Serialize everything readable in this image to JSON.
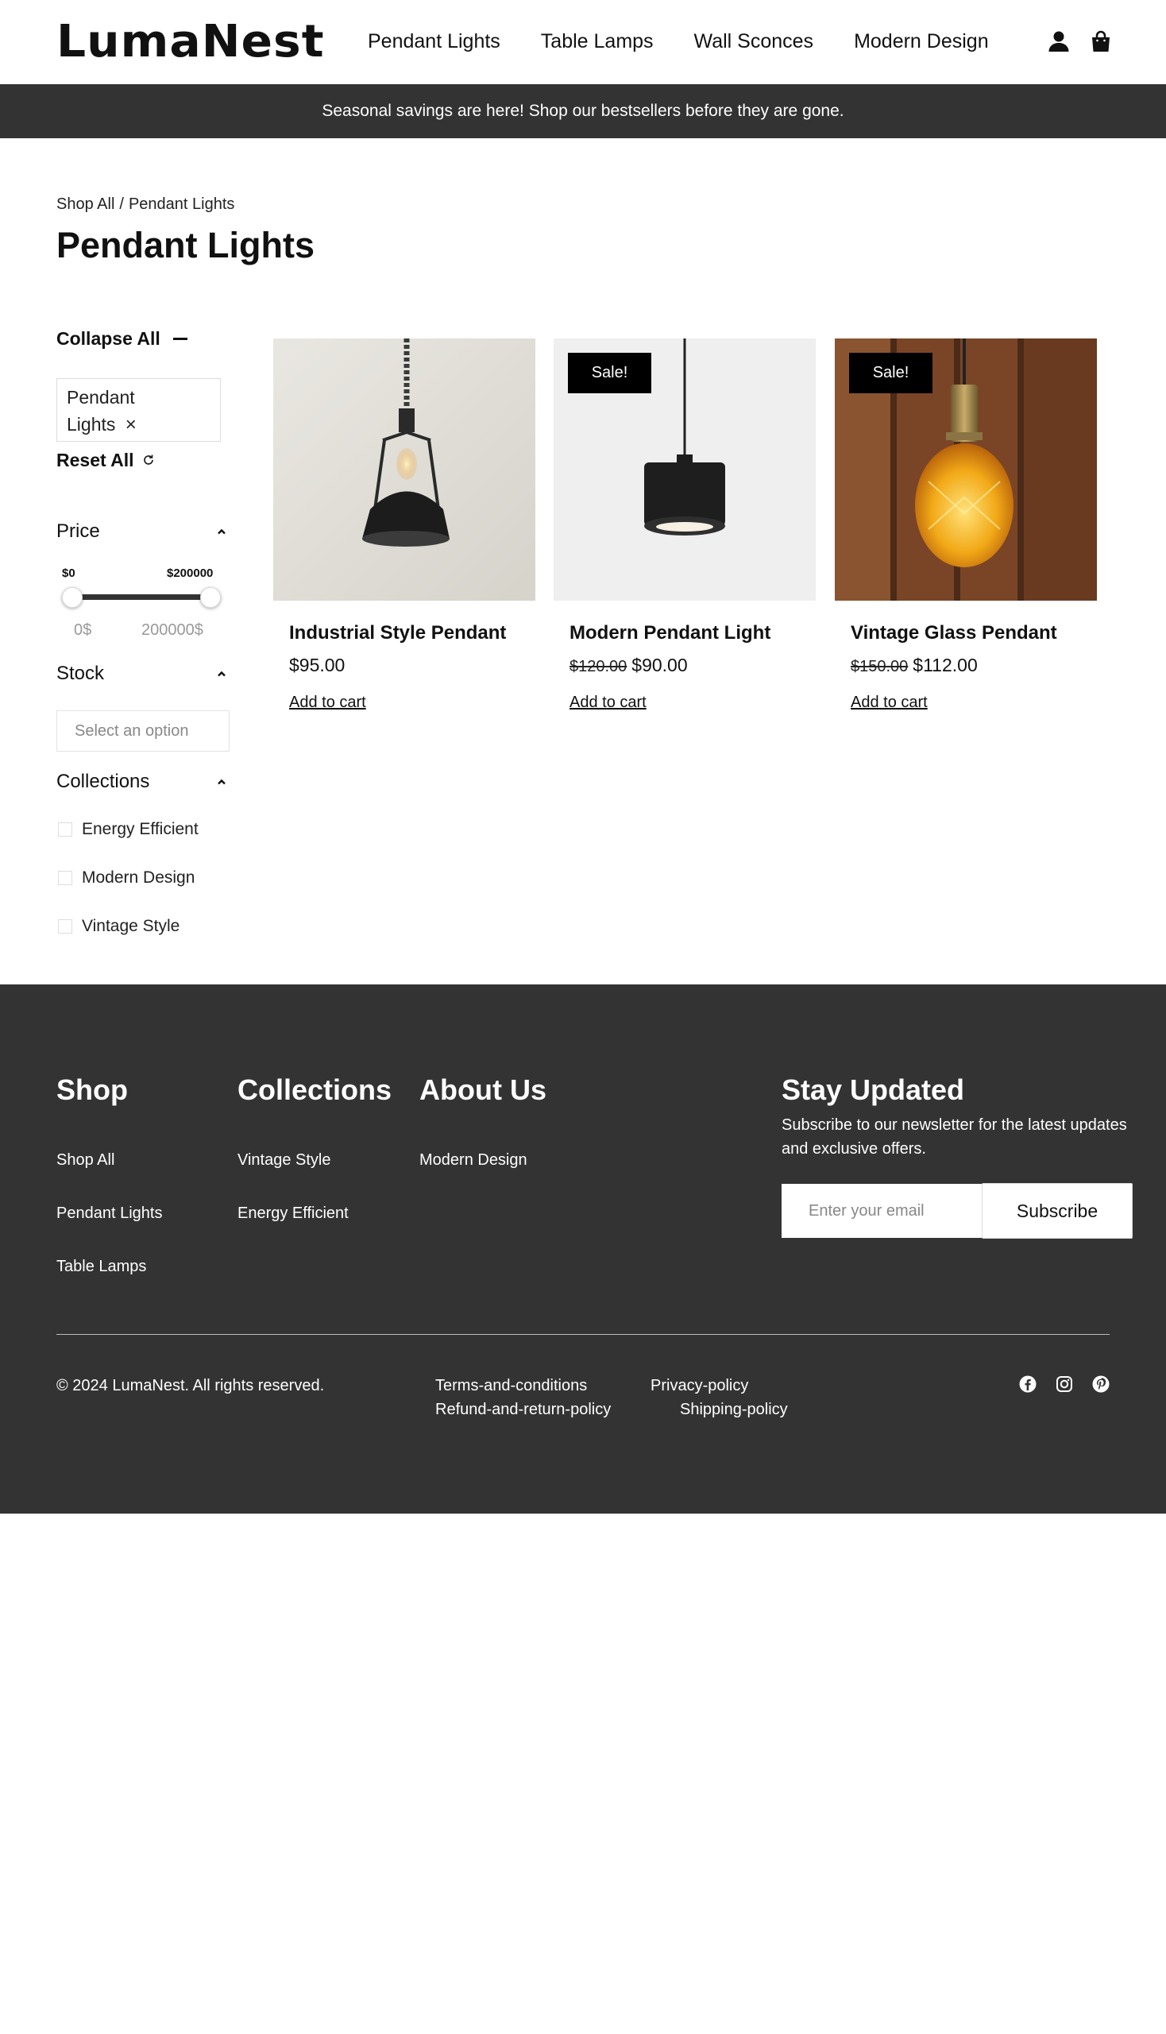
{
  "brand": {
    "logo": "LumaNest"
  },
  "nav": {
    "items": [
      "Pendant Lights",
      "Table Lamps",
      "Wall Sconces",
      "Modern Design"
    ]
  },
  "header_icons": [
    "account-icon",
    "cart-icon"
  ],
  "announcement": "Seasonal savings are here! Shop our bestsellers before they are gone.",
  "breadcrumb": {
    "items": [
      "Shop All",
      "/",
      "Pendant Lights"
    ]
  },
  "page_title": "Pendant Lights",
  "filters": {
    "collapse_all": "Collapse All",
    "active_chip": {
      "line1": "Pendant",
      "line2": "Lights",
      "remove": "×"
    },
    "reset_all": "Reset All",
    "price": {
      "label": "Price",
      "min_label": "$0",
      "max_label": "$200000",
      "range_min_text": "0$",
      "range_max_text": "200000$",
      "selected_min": 0,
      "selected_max": 200000
    },
    "stock": {
      "label": "Stock",
      "placeholder": "Select an option"
    },
    "collections": {
      "label": "Collections",
      "options": [
        {
          "label": "Energy Efficient",
          "checked": false
        },
        {
          "label": "Modern Design",
          "checked": false
        },
        {
          "label": "Vintage Style",
          "checked": false
        }
      ]
    }
  },
  "products": [
    {
      "name": "Industrial Style Pendant",
      "price": "$95.00",
      "old_price": "",
      "badge": "",
      "cta": "Add to cart"
    },
    {
      "name": "Modern Pendant Light",
      "price": "$90.00",
      "old_price": "$120.00",
      "badge": "Sale!",
      "cta": "Add to cart"
    },
    {
      "name": "Vintage Glass Pendant",
      "price": "$112.00",
      "old_price": "$150.00",
      "badge": "Sale!",
      "cta": "Add to cart"
    }
  ],
  "footer": {
    "columns": [
      {
        "title": "Shop",
        "links": [
          "Shop All",
          "Pendant Lights",
          "Table Lamps"
        ]
      },
      {
        "title": "Collections",
        "links": [
          "Vintage Style",
          "Energy Efficient"
        ]
      },
      {
        "title": "About Us",
        "links": [
          "Modern Design"
        ]
      }
    ],
    "newsletter": {
      "title": "Stay Updated",
      "desc": "Subscribe to our newsletter for the latest updates and exclusive offers.",
      "placeholder": "Enter your email",
      "button": "Subscribe"
    },
    "copyright": "© 2024 LumaNest. All rights reserved.",
    "policies": [
      "Terms-and-conditions",
      "Privacy-policy",
      "Refund-and-return-policy",
      "Shipping-policy"
    ],
    "social": [
      "facebook-icon",
      "instagram-icon",
      "pinterest-icon"
    ]
  },
  "colors": {
    "announcement_bg": "#333333",
    "footer_bg": "#333333",
    "badge_bg": "#000000"
  }
}
